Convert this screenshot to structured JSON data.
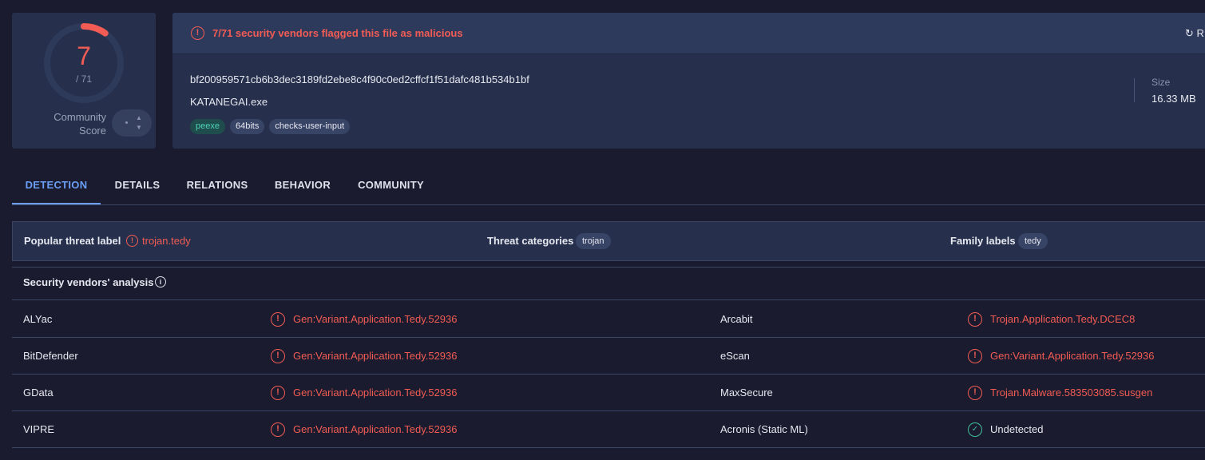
{
  "score": {
    "detections": "7",
    "total": "/ 71",
    "community_label_line1": "Community",
    "community_label_line2": "Score",
    "ring_color": "#f25c54",
    "track_color": "#2e3a5a",
    "detection_fraction": 0.0986
  },
  "banner": {
    "alert_text": "7/71 security vendors flagged this file as malicious",
    "reanalyze_label": "R",
    "alert_icon": "alert-circle-icon",
    "reanalyze_icon": "refresh-icon"
  },
  "file": {
    "hash": "bf200959571cb6b3dec3189fd2ebe8c4f90c0ed2cffcf1f51dafc481b534b1bf",
    "name": "KATANEGAI.exe",
    "tags": [
      "peexe",
      "64bits",
      "checks-user-input"
    ],
    "size_label": "Size",
    "size_value": "16.33 MB"
  },
  "tabs": [
    "DETECTION",
    "DETAILS",
    "RELATIONS",
    "BEHAVIOR",
    "COMMUNITY"
  ],
  "active_tab": "DETECTION",
  "threat": {
    "popular_label": "Popular threat label",
    "popular_value": "trojan.tedy",
    "categories_label": "Threat categories",
    "categories_value": "trojan",
    "family_label": "Family labels",
    "family_value": "tedy"
  },
  "vendors": {
    "title": "Security vendors' analysis",
    "rows": [
      {
        "left_name": "ALYac",
        "left_result": "Gen:Variant.Application.Tedy.52936",
        "left_status": "bad",
        "right_name": "Arcabit",
        "right_result": "Trojan.Application.Tedy.DCEC8",
        "right_status": "bad"
      },
      {
        "left_name": "BitDefender",
        "left_result": "Gen:Variant.Application.Tedy.52936",
        "left_status": "bad",
        "right_name": "eScan",
        "right_result": "Gen:Variant.Application.Tedy.52936",
        "right_status": "bad"
      },
      {
        "left_name": "GData",
        "left_result": "Gen:Variant.Application.Tedy.52936",
        "left_status": "bad",
        "right_name": "MaxSecure",
        "right_result": "Trojan.Malware.583503085.susgen",
        "right_status": "bad"
      },
      {
        "left_name": "VIPRE",
        "left_result": "Gen:Variant.Application.Tedy.52936",
        "left_status": "bad",
        "right_name": "Acronis (Static ML)",
        "right_result": "Undetected",
        "right_status": "good"
      }
    ]
  },
  "colors": {
    "malicious": "#f25c54",
    "clean": "#3fbf9a",
    "accent": "#6b9ef5",
    "card_bg": "#26304c",
    "page_bg": "#1a1b2e"
  }
}
